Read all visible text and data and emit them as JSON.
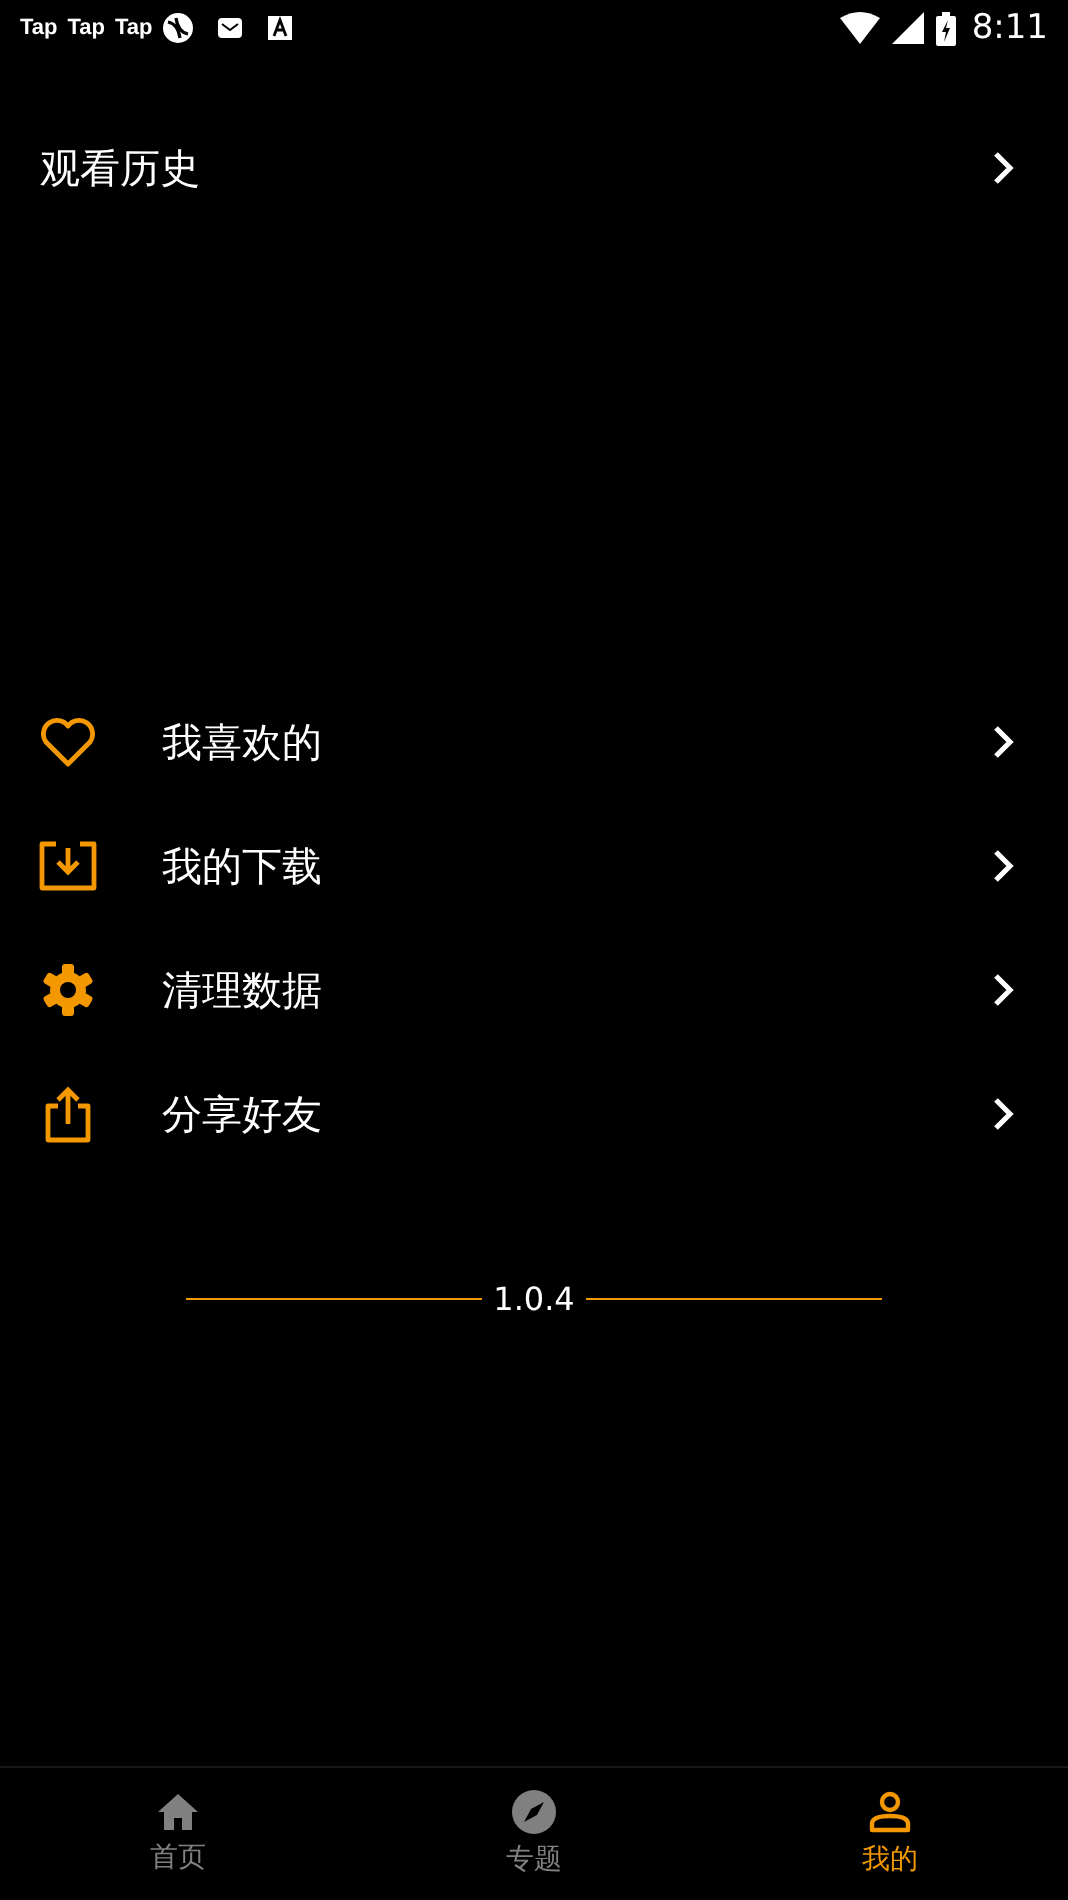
{
  "status_bar": {
    "notifications": [
      {
        "kind": "text",
        "label": "Tap"
      },
      {
        "kind": "text",
        "label": "Tap"
      },
      {
        "kind": "text",
        "label": "Tap"
      },
      {
        "kind": "ball"
      },
      {
        "kind": "mail"
      },
      {
        "kind": "store"
      }
    ],
    "time": "8:11"
  },
  "history": {
    "label": "观看历史"
  },
  "menu": [
    {
      "kind": "heart",
      "label": "我喜欢的"
    },
    {
      "kind": "download",
      "label": "我的下载"
    },
    {
      "kind": "gear",
      "label": "清理数据"
    },
    {
      "kind": "share",
      "label": "分享好友"
    }
  ],
  "version": "1.0.4",
  "nav": [
    {
      "kind": "home",
      "label": "首页",
      "selected": false
    },
    {
      "kind": "compass",
      "label": "专题",
      "selected": false
    },
    {
      "kind": "person",
      "label": "我的",
      "selected": true
    }
  ]
}
